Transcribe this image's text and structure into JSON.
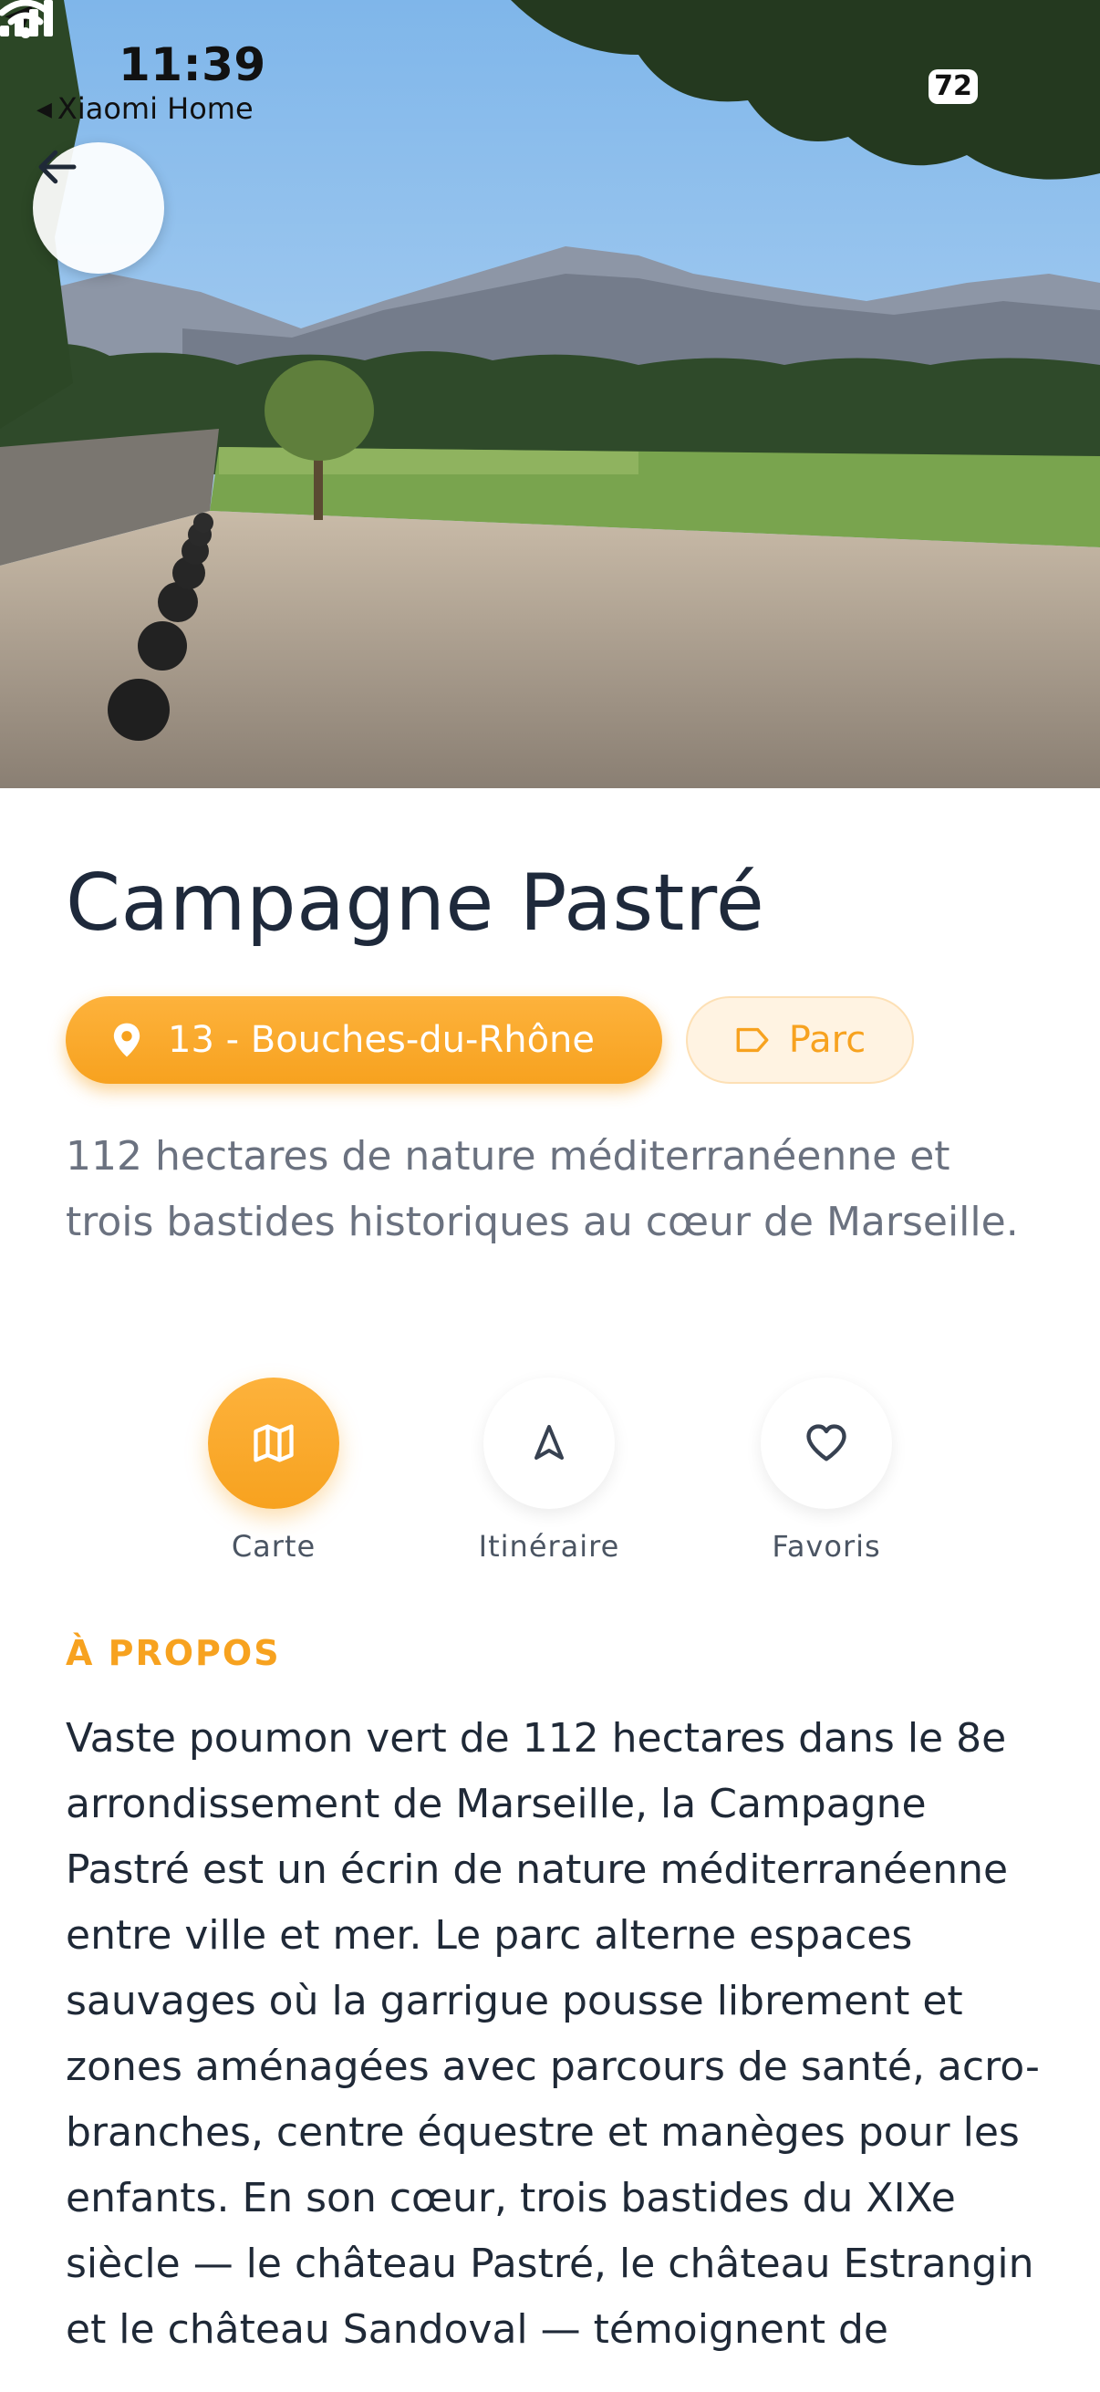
{
  "status_bar": {
    "time": "11:39",
    "back_app": "Xiaomi Home",
    "battery": "72"
  },
  "hero": {
    "icon": "arrow-left-icon"
  },
  "place": {
    "title": "Campagne Pastré",
    "location_chip": "13 - Bouches-du-Rhône",
    "type_chip": "Parc",
    "summary": "112 hectares de nature méditerranéenne et trois bastides historiques au cœur de Marseille."
  },
  "actions": [
    {
      "label": "Carte",
      "icon": "map-icon",
      "active": true
    },
    {
      "label": "Itinéraire",
      "icon": "navigation-icon",
      "active": false
    },
    {
      "label": "Favoris",
      "icon": "heart-icon",
      "active": false
    }
  ],
  "about": {
    "heading": "À PROPOS",
    "text": "Vaste poumon vert de 112 hectares dans le 8e arrondissement de Marseille, la Campagne Pastré est un écrin de nature méditerranéenne entre ville et mer. Le parc alterne espaces sauvages où la garrigue pousse librement et zones aménagées avec parcours de santé, acro-branches, centre équestre et manèges pour les enfants. En son cœur, trois bastides du XIXe siècle — le château Pastré, le château Estrangin et le château Sandoval — témoignent de"
  },
  "colors": {
    "accent": "#f7a21f",
    "accent_light": "#fff3e2",
    "title": "#1e293b",
    "muted": "#6b7280"
  }
}
